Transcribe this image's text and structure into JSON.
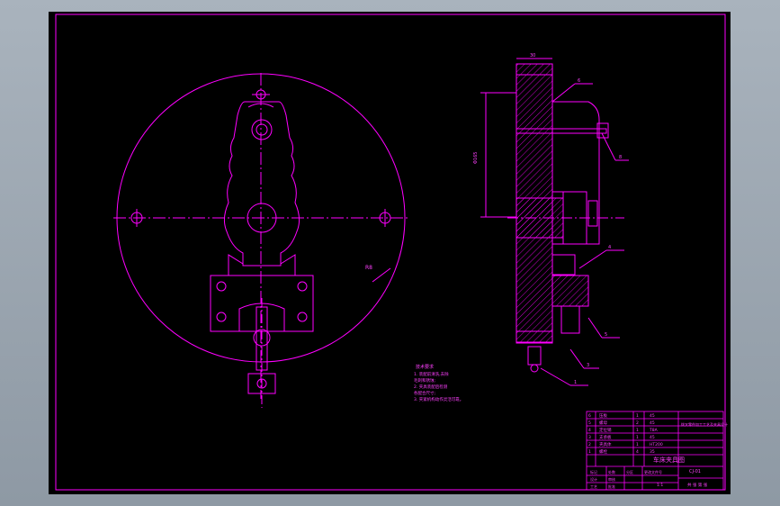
{
  "colors": {
    "background": "#000000",
    "frame": "#ff00ff",
    "linework": "#ff00ff",
    "window": "#9aa5b0"
  },
  "drawing": {
    "radius_label": "R8",
    "plan_title": "技术要求",
    "notes": [
      "1. 装配前清洗,去除",
      "   毛刺和锈蚀;",
      "2. 夹具装配后检测",
      "   各配合尺寸;",
      "3. 夹紧机构动作灵活可靠。"
    ],
    "balloons": [
      "6",
      "8",
      "4",
      "5",
      "3",
      "1"
    ],
    "dim_top": "30",
    "dim_left": "Φ165"
  },
  "title_block": {
    "drawing_name": "车床夹具图",
    "school": "拨叉零件加工工艺及夹具设计",
    "drawing_no": "CJ-01",
    "scale": "1:1",
    "sheet": "共 张 第 张",
    "parts": [
      [
        "6",
        "压板",
        "1",
        "45"
      ],
      [
        "5",
        "螺母",
        "2",
        "45"
      ],
      [
        "4",
        "定位销",
        "1",
        "T8A"
      ],
      [
        "3",
        "支承板",
        "1",
        "45"
      ],
      [
        "2",
        "夹具体",
        "1",
        "HT200"
      ],
      [
        "1",
        "螺栓",
        "4",
        "35"
      ]
    ],
    "row_labels": [
      "标记",
      "处数",
      "分区",
      "更改文件号",
      "签名",
      "日期"
    ],
    "sign_labels": [
      "设计",
      "审核",
      "工艺",
      "批准"
    ]
  }
}
